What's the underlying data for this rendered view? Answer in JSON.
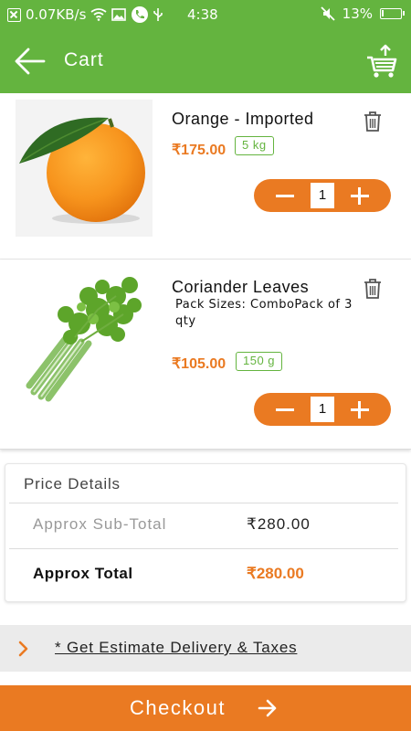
{
  "status_bar": {
    "network_speed": "0.07KB/s",
    "time": "4:38",
    "battery_percent": "13%",
    "battery_level": 0.13
  },
  "app_bar": {
    "title": "Cart",
    "back_icon": "arrow-left-icon",
    "cart_icon": "cart-upload-icon"
  },
  "items": [
    {
      "name": "Orange - Imported",
      "price": "₹175.00",
      "pack_size": "5 kg",
      "quantity": "1",
      "image": "orange"
    },
    {
      "name": "Coriander Leaves",
      "pack_sizes_label": "Pack Sizes:",
      "pack_sizes_value": "ComboPack of 3 qty",
      "price": "₹105.00",
      "pack_size": "150 g",
      "quantity": "1",
      "image": "coriander"
    }
  ],
  "price_details": {
    "title": "Price Details",
    "subtotal_label": "Approx Sub-Total",
    "subtotal_value": "₹280.00",
    "total_label": "Approx Total",
    "total_value": "₹280.00"
  },
  "estimate": {
    "label": "* Get Estimate Delivery & Taxes"
  },
  "checkout": {
    "label": "Checkout"
  },
  "colors": {
    "brand_green": "#64b43f",
    "accent_orange": "#ea7a22"
  }
}
